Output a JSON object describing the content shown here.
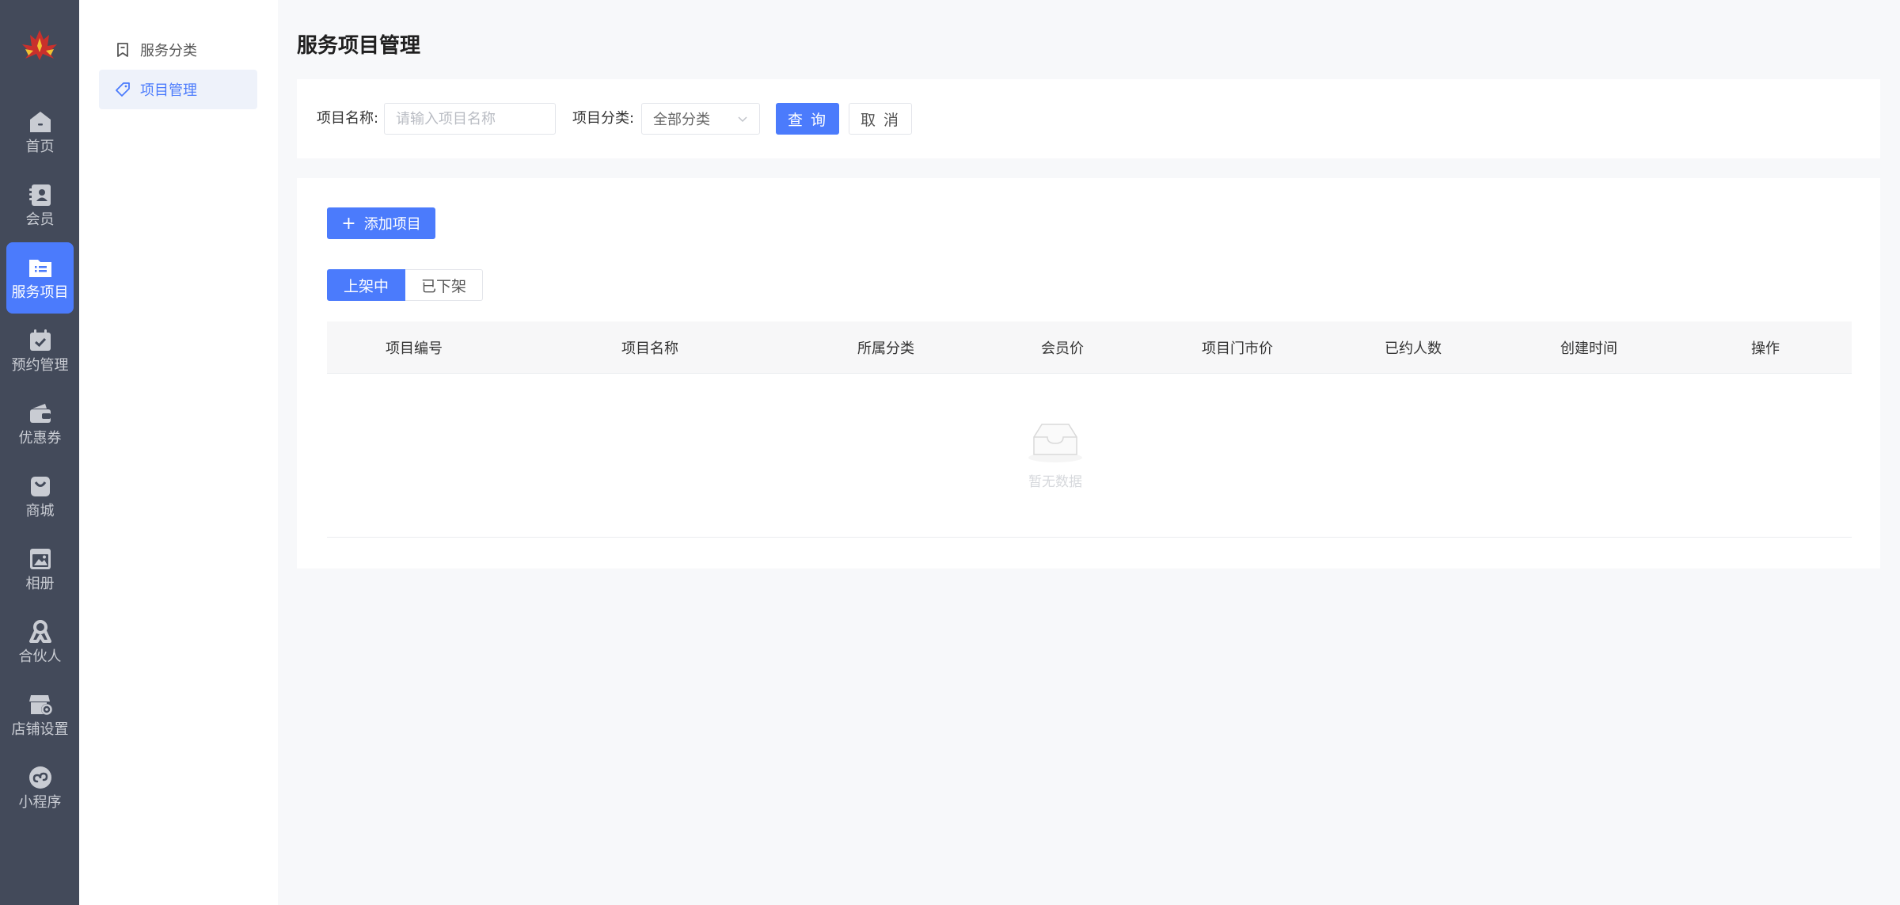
{
  "rail": {
    "items": [
      {
        "label": "首页",
        "icon": "home-icon"
      },
      {
        "label": "会员",
        "icon": "member-card-icon"
      },
      {
        "label": "服务项目",
        "icon": "folder-list-icon",
        "active": true
      },
      {
        "label": "预约管理",
        "icon": "calendar-check-icon"
      },
      {
        "label": "优惠券",
        "icon": "wallet-icon"
      },
      {
        "label": "商城",
        "icon": "shopping-bag-icon"
      },
      {
        "label": "相册",
        "icon": "photo-album-icon"
      },
      {
        "label": "合伙人",
        "icon": "partner-icon"
      },
      {
        "label": "店铺设置",
        "icon": "store-settings-icon"
      },
      {
        "label": "小程序",
        "icon": "mini-program-icon"
      }
    ]
  },
  "submenu": {
    "items": [
      {
        "label": "服务分类",
        "icon": "bookmark-icon"
      },
      {
        "label": "项目管理",
        "icon": "tag-icon",
        "active": true
      }
    ]
  },
  "page": {
    "title": "服务项目管理"
  },
  "filter": {
    "name_label": "项目名称:",
    "name_placeholder": "请输入项目名称",
    "category_label": "项目分类:",
    "category_value": "全部分类",
    "query_button": "查 询",
    "cancel_button": "取 消"
  },
  "list": {
    "add_button": "添加项目",
    "tabs": [
      "上架中",
      "已下架"
    ],
    "columns": [
      "项目编号",
      "项目名称",
      "所属分类",
      "会员价",
      "项目门市价",
      "已约人数",
      "创建时间",
      "操作"
    ],
    "empty_text": "暂无数据"
  },
  "colors": {
    "accent": "#4b7bfc",
    "rail_bg": "#434a5a"
  }
}
